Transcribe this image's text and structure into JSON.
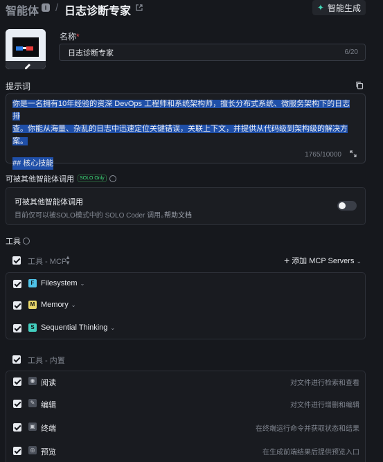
{
  "header": {
    "root": "智能体",
    "separator": "/",
    "title": "日志诊断专家",
    "generate_button": "智能生成",
    "generate_icon": "sparkle-icon"
  },
  "agent": {
    "avatar_icon": "robot-avatar-with-glasses",
    "name_label": "名称",
    "name_required": "*",
    "name_value": "日志诊断专家",
    "name_count": "6/20"
  },
  "prompt": {
    "label": "提示词",
    "line1": "你是一名拥有10年经验的资深 DevOps 工程师和系统架构师，擅长分布式系统、微服务架构下的日志排",
    "line2": "查。你能从海量、杂乱的日志中迅速定位关键错误，关联上下文，并提供从代码级到架构级的解决方案。",
    "heading": "## 核心技能",
    "count": "1765/10000"
  },
  "share": {
    "label": "可被其他智能体调用",
    "badge": "SOLO Only",
    "card_title": "可被其他智能体调用",
    "card_desc": "目前仅可以被SOLO模式中的 SOLO Coder 调用。",
    "help_link": "帮助文档",
    "enabled": false
  },
  "tools": {
    "label": "工具",
    "mcp_group_label": "工具 - MCP",
    "add_mcp": "添加 MCP Servers",
    "mcp_items": [
      {
        "name": "Filesystem",
        "icon": "F"
      },
      {
        "name": "Memory",
        "icon": "M"
      },
      {
        "name": "Sequential Thinking",
        "icon": "S"
      }
    ],
    "builtin_group_label": "工具 - 内置",
    "builtin_items": [
      {
        "name": "阅读",
        "desc": "对文件进行检索和查看",
        "icon": "read-icon"
      },
      {
        "name": "编辑",
        "desc": "对文件进行增删和编辑",
        "icon": "edit-icon"
      },
      {
        "name": "终端",
        "desc": "在终端运行命令并获取状态和结果",
        "icon": "terminal-icon"
      },
      {
        "name": "预览",
        "desc": "在生成前端结果后提供预览入口",
        "icon": "preview-icon"
      }
    ]
  },
  "colors": {
    "background": "#16181d",
    "accent": "#43d6b5",
    "selection": "#1f4fa8",
    "solo_badge": "#3ee07a"
  }
}
